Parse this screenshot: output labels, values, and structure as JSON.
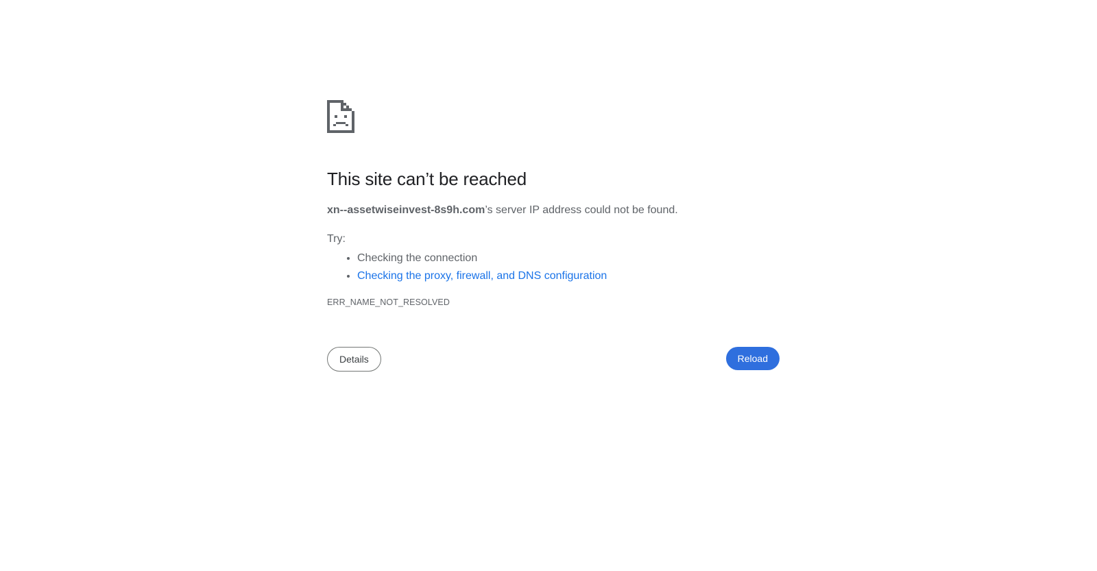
{
  "error_icon": "sad-page-icon",
  "heading": "This site can’t be reached",
  "summary": {
    "host": "xn--assetwiseinvest-8s9h.com",
    "message": "’s server IP address could not be found."
  },
  "try_label": "Try:",
  "suggestions": [
    {
      "text": "Checking the connection",
      "is_link": false
    },
    {
      "text": "Checking the proxy, firewall, and DNS configuration",
      "is_link": true
    }
  ],
  "error_code": "ERR_NAME_NOT_RESOLVED",
  "buttons": {
    "details_label": "Details",
    "reload_label": "Reload"
  },
  "colors": {
    "link": "#1a73e8",
    "primary_button": "#2f6fde",
    "heading": "#202124",
    "body_text": "#5f6368"
  }
}
